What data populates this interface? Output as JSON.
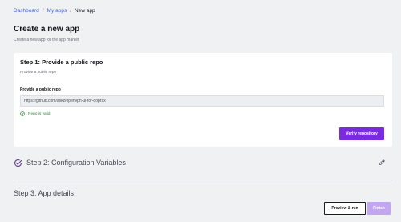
{
  "breadcrumb": {
    "items": [
      "Dashboard",
      "My apps"
    ],
    "separator": "/",
    "current": "New app"
  },
  "header": {
    "title": "Create a new app",
    "subtitle": "Create a new app for the app market"
  },
  "step1": {
    "title": "Step 1: Provide a public repo",
    "description": "Provide a public repo",
    "field_label": "Provide a public repo",
    "repo_value": "https://github.com/askz/openvpn-ui-for-doprax",
    "valid_text": "Repo is valid",
    "verify_label": "Verify repository"
  },
  "step2": {
    "title": "Step 2: Configuration Variables",
    "icon": "check-circle-icon",
    "action_icon": "pencil-icon"
  },
  "step3": {
    "title": "Step 3: App details"
  },
  "footer": {
    "preview_label": "Preview & run",
    "finish_label": "Finish"
  },
  "colors": {
    "accent": "#7a2be0",
    "accent_disabled": "#c2a6ef",
    "link": "#3f63d6",
    "success": "#2f8a3d",
    "background": "#f0f1f3",
    "card": "#ffffff"
  }
}
